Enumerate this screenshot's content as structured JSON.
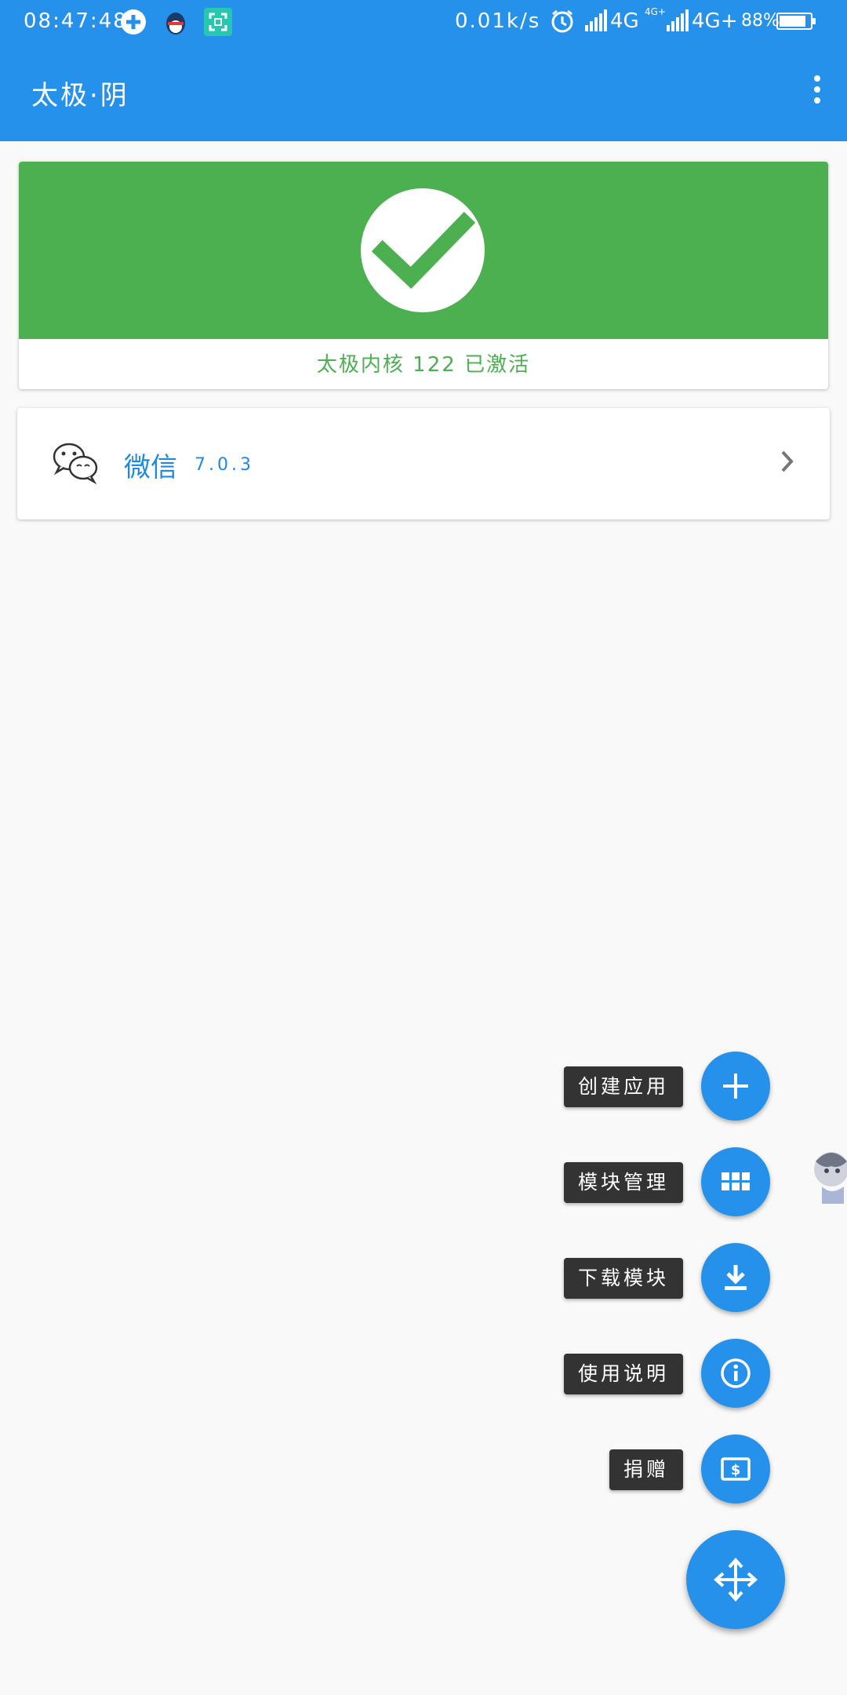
{
  "status_bar": {
    "time": "08:47:48",
    "speed": "0.01k/s",
    "net1": "4G",
    "net2_top": "4G+",
    "net2": "4G+",
    "battery_pct": "88%",
    "battery_level": 0.88,
    "icons": [
      "medical-plus-icon",
      "qq-penguin-icon",
      "scan-icon",
      "alarm-icon",
      "signal-icon",
      "battery-icon"
    ]
  },
  "app_bar": {
    "title": "太极·阴",
    "menu_icon": "more-vert-icon"
  },
  "status_card": {
    "text": "太极内核 122 已激活",
    "icon": "check-icon",
    "color": "#4caf50"
  },
  "app_list": [
    {
      "name": "微信",
      "version": "7.0.3",
      "icon": "wechat-icon"
    }
  ],
  "fab_menu": [
    {
      "label": "创建应用",
      "icon": "plus-icon"
    },
    {
      "label": "模块管理",
      "icon": "grid-icon"
    },
    {
      "label": "下载模块",
      "icon": "download-icon"
    },
    {
      "label": "使用说明",
      "icon": "info-icon"
    },
    {
      "label": "捐赠",
      "icon": "donate-icon"
    }
  ],
  "fab_main_icon": "move-arrows-icon",
  "colors": {
    "primary": "#2591ea",
    "success": "#4caf50",
    "label_bg": "#333333"
  }
}
